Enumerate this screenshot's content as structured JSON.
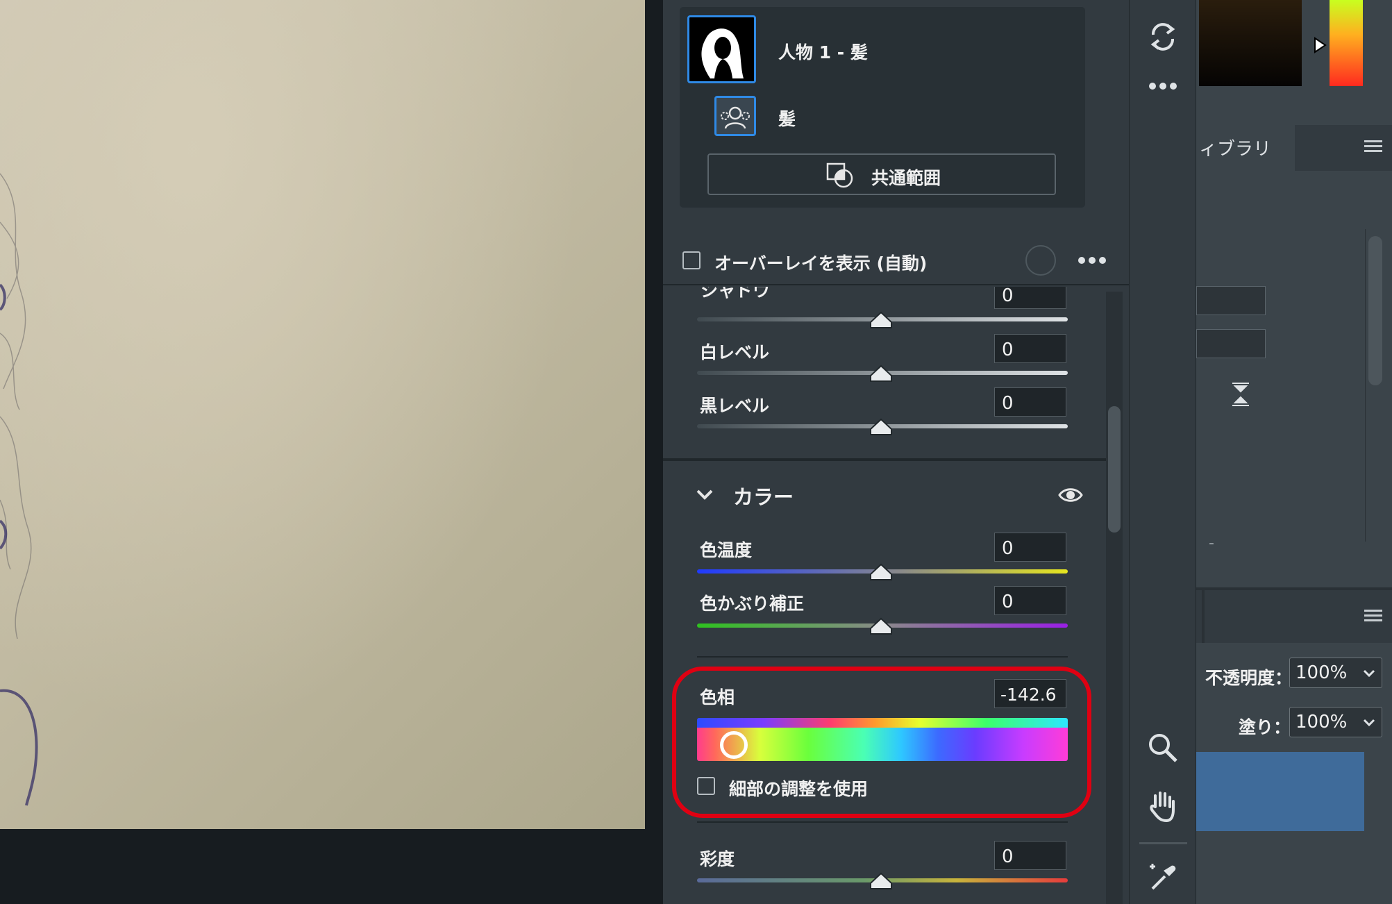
{
  "mask": {
    "title": "人物 1 - 髪",
    "sub_label": "髪",
    "common_range_label": "共通範囲"
  },
  "overlay": {
    "label": "オーバーレイを表示 (自動)"
  },
  "sliders_top": [
    {
      "label": "シャドウ",
      "value": "0"
    },
    {
      "label": "白レベル",
      "value": "0"
    },
    {
      "label": "黒レベル",
      "value": "0"
    }
  ],
  "color_section": {
    "title": "カラー",
    "temperature": {
      "label": "色温度",
      "value": "0"
    },
    "tint": {
      "label": "色かぶり補正",
      "value": "0"
    },
    "hue": {
      "label": "色相",
      "value": "-142.6"
    },
    "fine_adjust_label": "細部の調整を使用",
    "saturation": {
      "label": "彩度",
      "value": "0"
    }
  },
  "right_panel": {
    "library_tab": "ィブラリ",
    "opacity_label": "不透明度：",
    "opacity_value": "100%",
    "fill_label": "塗り：",
    "fill_value": "100%",
    "dash": "-"
  },
  "colors": {
    "highlight": "#e00012",
    "selection": "#2f8ae6",
    "layer_selected": "#3f6b9a"
  },
  "icons": [
    "sync-icon",
    "more-icon",
    "zoom-icon",
    "hand-icon",
    "color-sampler-icon",
    "eye-icon",
    "chevron-down-icon",
    "menu-icon"
  ]
}
